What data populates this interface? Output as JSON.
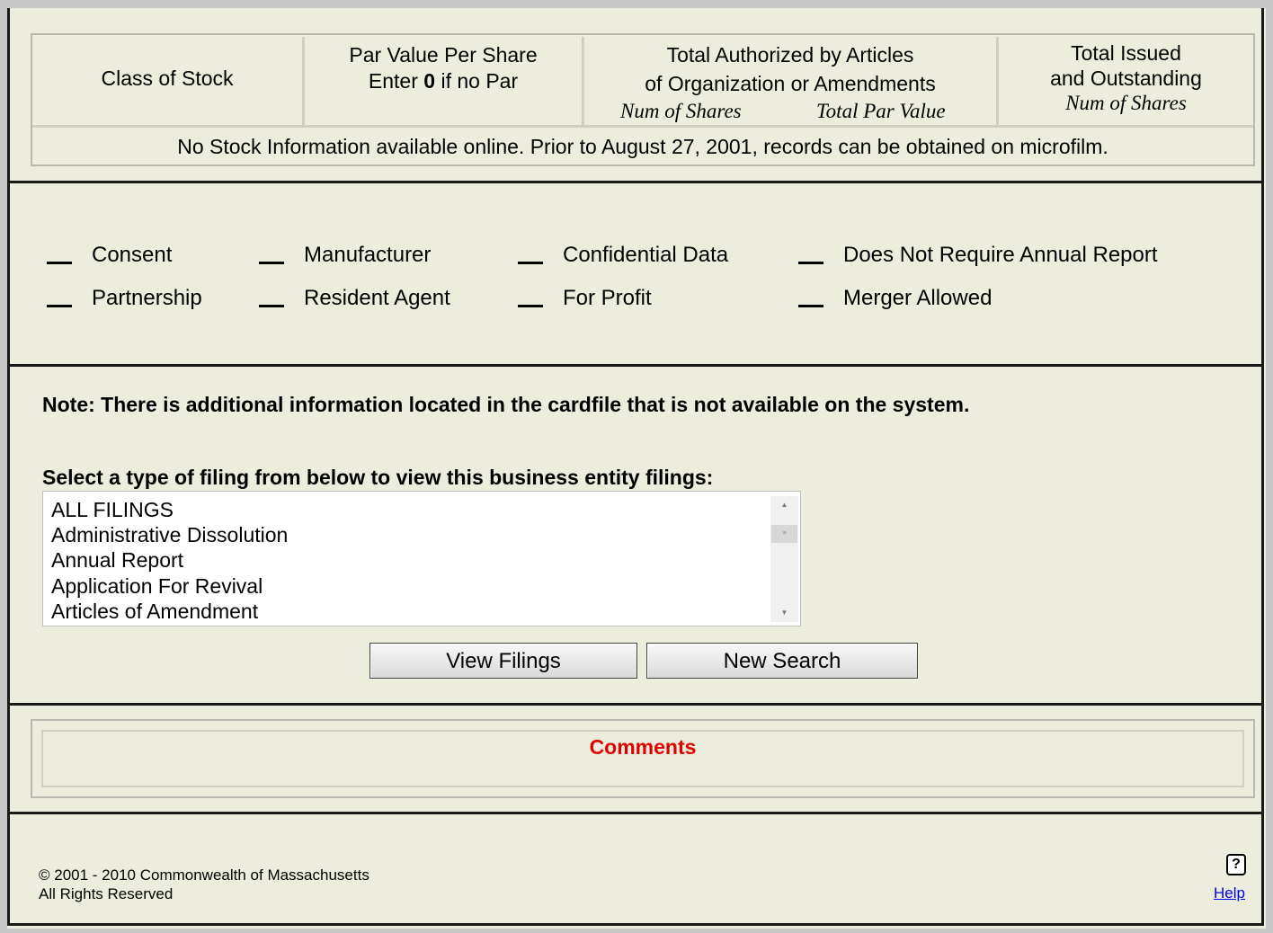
{
  "stock_table": {
    "col_class": "Class of Stock",
    "col_par_line1": "Par Value Per Share",
    "col_par_line2_pre": "Enter ",
    "col_par_line2_bold": "0",
    "col_par_line2_post": " if no Par",
    "col_auth_line1": "Total Authorized by Articles",
    "col_auth_line2": "of Organization or Amendments",
    "col_auth_sub1": "Num of Shares",
    "col_auth_sub2": "Total Par Value",
    "col_issued_line1": "Total Issued",
    "col_issued_line2": "and Outstanding",
    "col_issued_sub": "Num of Shares",
    "no_info": "No Stock Information available online. Prior to August 27, 2001, records can be obtained on microfilm."
  },
  "flags": [
    {
      "mark": "__",
      "label": "Consent"
    },
    {
      "mark": "__",
      "label": "Manufacturer"
    },
    {
      "mark": "__",
      "label": "Confidential Data"
    },
    {
      "mark": "__",
      "label": "Does Not Require Annual Report"
    },
    {
      "mark": "__",
      "label": "Partnership"
    },
    {
      "mark": "__",
      "label": "Resident Agent"
    },
    {
      "mark": "__",
      "label": "For Profit"
    },
    {
      "mark": "__",
      "label": "Merger Allowed"
    }
  ],
  "filings": {
    "note": "Note: There is additional information located in the cardfile that is not available on the system.",
    "select_label": "Select a type of filing from below to view this business entity filings:",
    "options": [
      "ALL FILINGS",
      "Administrative Dissolution",
      "Annual Report",
      "Application For Revival",
      "Articles of Amendment"
    ],
    "view_button": "View Filings",
    "new_search_button": "New Search"
  },
  "comments": {
    "title": "Comments"
  },
  "footer": {
    "copyright": "© 2001 - 2010 Commonwealth of Massachusetts",
    "rights": "All Rights Reserved",
    "help_icon": "question-mark-icon",
    "help_link": "Help"
  }
}
